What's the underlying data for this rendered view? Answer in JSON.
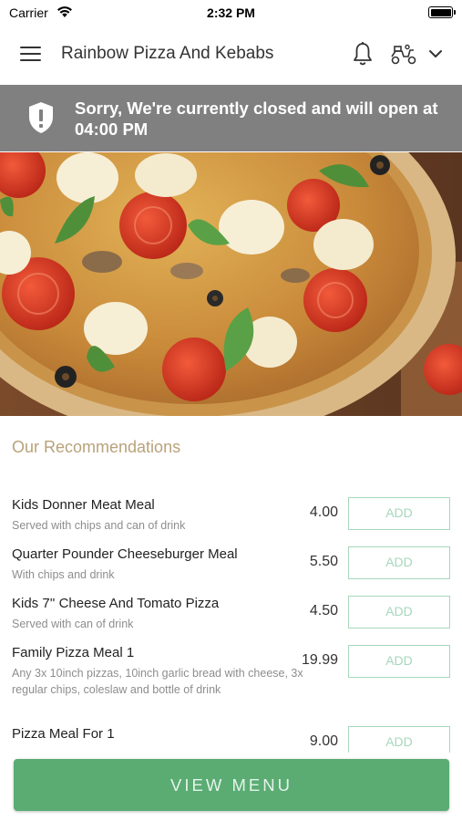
{
  "status_bar": {
    "carrier": "Carrier",
    "time": "2:32 PM"
  },
  "header": {
    "title": "Rainbow Pizza And Kebabs",
    "icons": [
      "menu-icon",
      "bell-icon",
      "delivery-scooter-icon",
      "chevron-down-icon"
    ]
  },
  "closed_banner": {
    "message": "Sorry, We're currently closed and will open at 04:00 PM",
    "icon": "shield-exclamation-icon",
    "background_color": "#808080"
  },
  "hero": {
    "image": "pizza-photo"
  },
  "recommendations": {
    "title": "Our Recommendations",
    "items": [
      {
        "name": "Kids Donner Meat Meal",
        "description": "Served with chips and can of drink",
        "price": "4.00",
        "add_label": "ADD"
      },
      {
        "name": "Quarter Pounder Cheeseburger Meal",
        "description": "With chips and drink",
        "price": "5.50",
        "add_label": "ADD"
      },
      {
        "name": "Kids 7'' Cheese And Tomato Pizza",
        "description": "Served with can of drink",
        "price": "4.50",
        "add_label": "ADD"
      },
      {
        "name": "Family Pizza Meal 1",
        "description": "Any 3x 10inch pizzas, 10inch garlic bread with cheese, 3x regular chips, coleslaw and  bottle of drink",
        "price": "19.99",
        "add_label": "ADD"
      },
      {
        "name": "Pizza Meal For 1",
        "description": "",
        "price": "9.00",
        "add_label": "ADD"
      }
    ]
  },
  "footer": {
    "view_menu_label": "VIEW MENU",
    "button_color": "#5aac73"
  },
  "colors": {
    "accent_green": "#5aac73",
    "add_border": "#a6d7bb",
    "section_title": "#b8a27a"
  }
}
